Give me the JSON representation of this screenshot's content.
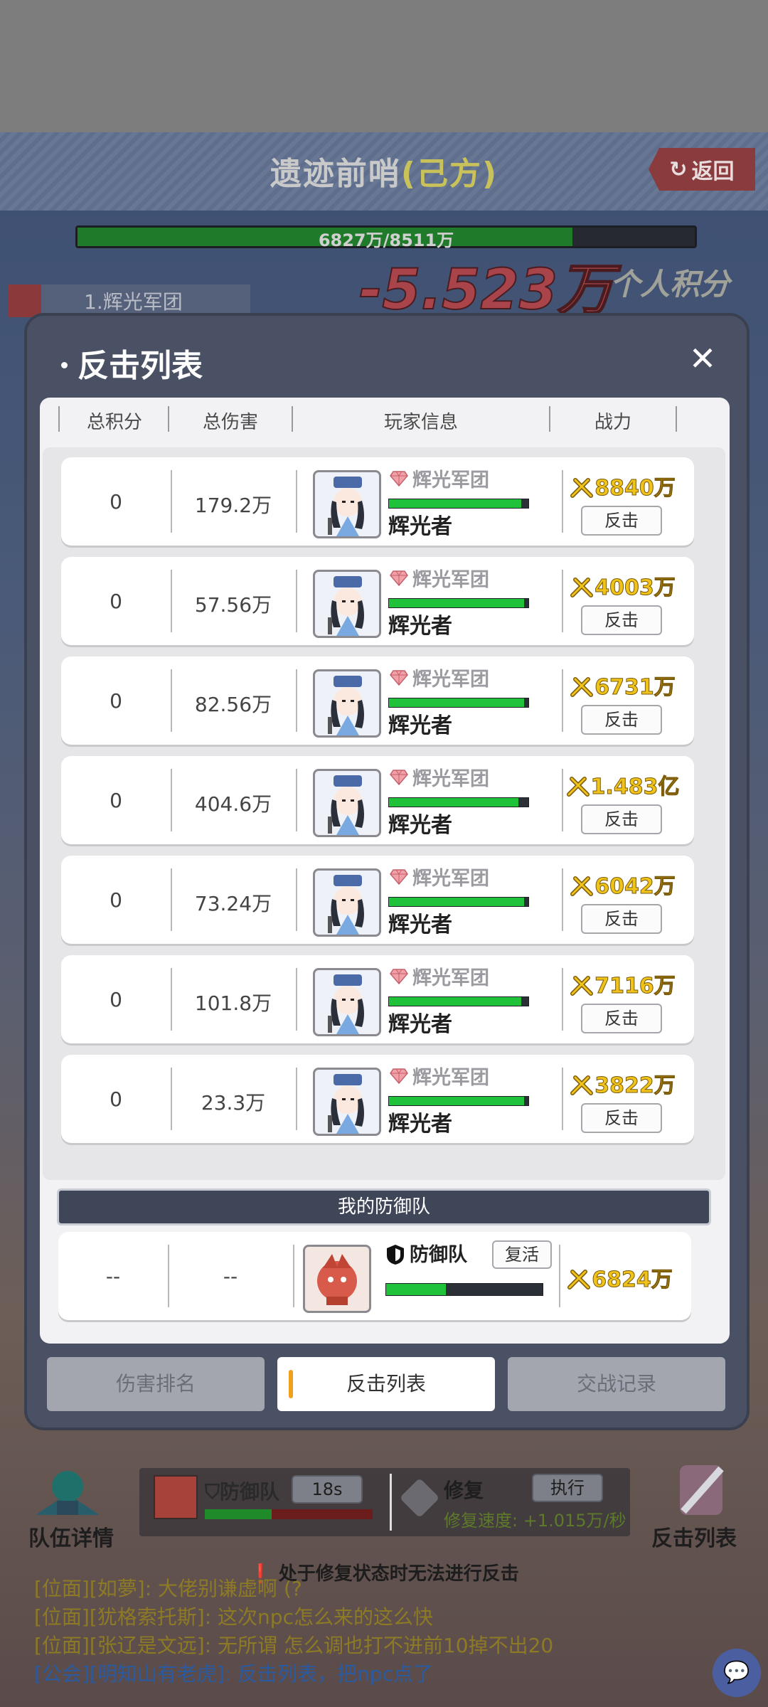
{
  "scene": {
    "title": "遗迹前哨",
    "title_suffix": "(己方)",
    "back_label": "返回",
    "hp_text": "6827万/8511万",
    "hp_fraction": 0.802,
    "damage_text": "-5.523万",
    "personal_score_label": "个人积分",
    "team_tag": "1.辉光军团"
  },
  "modal": {
    "title": "反击列表",
    "close_icon": "close-icon",
    "columns": [
      "总积分",
      "总伤害",
      "玩家信息",
      "战力"
    ],
    "rows": [
      {
        "score": "0",
        "damage": "179.2万",
        "guild": "辉光军团",
        "name": "辉光者",
        "hp_fraction": 0.95,
        "power": "8840万",
        "action": "反击"
      },
      {
        "score": "0",
        "damage": "57.56万",
        "guild": "辉光军团",
        "name": "辉光者",
        "hp_fraction": 0.97,
        "power": "4003万",
        "action": "反击"
      },
      {
        "score": "0",
        "damage": "82.56万",
        "guild": "辉光军团",
        "name": "辉光者",
        "hp_fraction": 0.97,
        "power": "6731万",
        "action": "反击"
      },
      {
        "score": "0",
        "damage": "404.6万",
        "guild": "辉光军团",
        "name": "辉光者",
        "hp_fraction": 0.93,
        "power": "1.483亿",
        "action": "反击"
      },
      {
        "score": "0",
        "damage": "73.24万",
        "guild": "辉光军团",
        "name": "辉光者",
        "hp_fraction": 0.97,
        "power": "6042万",
        "action": "反击"
      },
      {
        "score": "0",
        "damage": "101.8万",
        "guild": "辉光军团",
        "name": "辉光者",
        "hp_fraction": 0.95,
        "power": "7116万",
        "action": "反击"
      },
      {
        "score": "0",
        "damage": "23.3万",
        "guild": "辉光军团",
        "name": "辉光者",
        "hp_fraction": 0.97,
        "power": "3822万",
        "action": "反击"
      }
    ],
    "my_defense": {
      "header": "我的防御队",
      "score": "--",
      "damage": "--",
      "name": "防御队",
      "revive_label": "复活",
      "hp_fraction": 0.38,
      "power": "6824万"
    },
    "tabs": [
      "伤害排名",
      "反击列表",
      "交战记录"
    ],
    "active_tab": 1
  },
  "hud": {
    "team_details": "队伍详情",
    "counter_list": "反击列表",
    "def_label": "防御队",
    "timer": "18s",
    "repair_label": "修复",
    "execute_label": "执行",
    "repair_speed": "修复速度: +1.015万/秒",
    "warning": "处于修复状态时无法进行反击"
  },
  "chat": [
    {
      "channel": "[位面]",
      "user": "[如夢]",
      "text": ": 大佬别谦虚啊 (?",
      "kind": "pos"
    },
    {
      "channel": "[位面]",
      "user": "[犹格索托斯]",
      "text": ": 这次npc怎么来的这么快",
      "kind": "pos"
    },
    {
      "channel": "[位面]",
      "user": "[张辽是文远]",
      "text": ": 无所谓 怎么调也打不进前10掉不出20",
      "kind": "pos"
    },
    {
      "channel": "[公会]",
      "user": "[明知山有老虎]",
      "text": ": 反击列表，把npc点了",
      "kind": "guild"
    }
  ],
  "colors": {
    "modal_bg": "#4a5164",
    "power_gold": "#f0c31a",
    "hp_green": "#20c23a",
    "tab_accent": "#f0a01c"
  }
}
